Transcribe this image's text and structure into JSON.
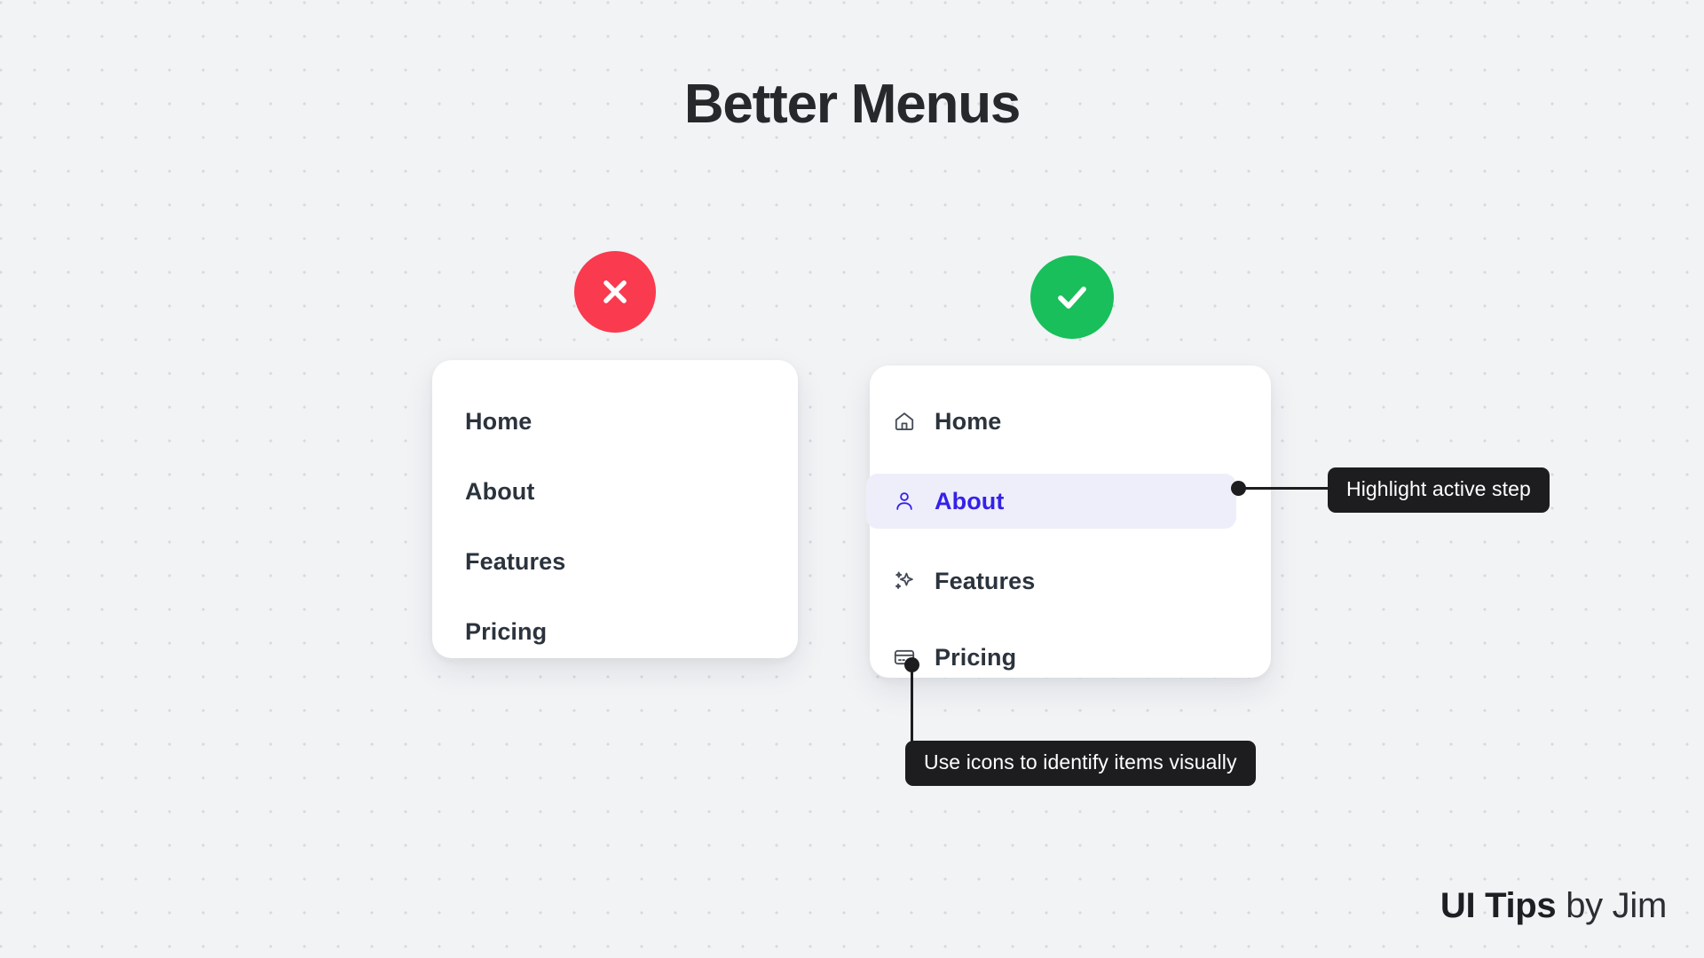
{
  "page": {
    "title": "Better Menus",
    "background_color": "#f1f3f5",
    "dot_color": "#d6dade"
  },
  "badges": {
    "bad": {
      "icon": "close-icon",
      "color": "#f93a4f",
      "meaning": "don't"
    },
    "good": {
      "icon": "check-icon",
      "color": "#18bf5a",
      "meaning": "do"
    }
  },
  "bad_menu": {
    "items": [
      {
        "label": "Home"
      },
      {
        "label": "About"
      },
      {
        "label": "Features"
      },
      {
        "label": "Pricing"
      }
    ]
  },
  "good_menu": {
    "active_bg": "#eeeefb",
    "active_color": "#3521e8",
    "items": [
      {
        "label": "Home",
        "icon": "home-icon",
        "active": false
      },
      {
        "label": "About",
        "icon": "user-icon",
        "active": true
      },
      {
        "label": "Features",
        "icon": "sparkles-icon",
        "active": false
      },
      {
        "label": "Pricing",
        "icon": "credit-card-icon",
        "active": false
      }
    ]
  },
  "callouts": {
    "active_step": "Highlight active step",
    "icons": "Use icons to identify items visually"
  },
  "footer": {
    "brand": "UI Tips",
    "byline": "by Jim"
  }
}
